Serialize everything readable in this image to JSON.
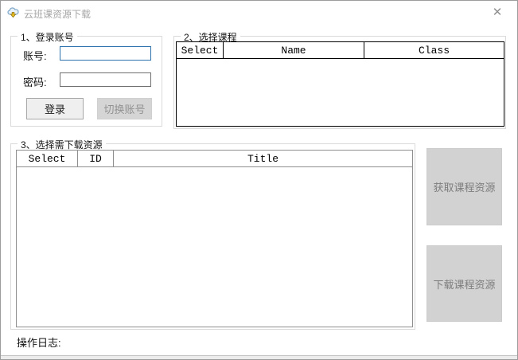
{
  "window": {
    "title": "云班课资源下载",
    "close_glyph": "✕"
  },
  "login_group": {
    "title": "1、登录账号",
    "account_label": "账号:",
    "account_value": "",
    "password_label": "密码:",
    "password_value": "",
    "login_button": "登录",
    "switch_account_button": "切换账号"
  },
  "course_group": {
    "title": "2、选择课程",
    "columns": [
      "Select",
      "Name",
      "Class"
    ],
    "rows": []
  },
  "resource_group": {
    "title": "3、选择需下载资源",
    "columns": [
      "Select",
      "ID",
      "Title"
    ],
    "rows": []
  },
  "actions": {
    "fetch_resources_button": "获取课程资源",
    "download_resources_button": "下载课程资源"
  },
  "log": {
    "label": "操作日志:"
  },
  "colors": {
    "focused_input_border": "#2d71ad",
    "normal_input_border": "#6f6f6f",
    "disabled_button_bg": "#d5d5d5",
    "disabled_button_text": "#929292",
    "title_text": "#a5a5a5"
  }
}
